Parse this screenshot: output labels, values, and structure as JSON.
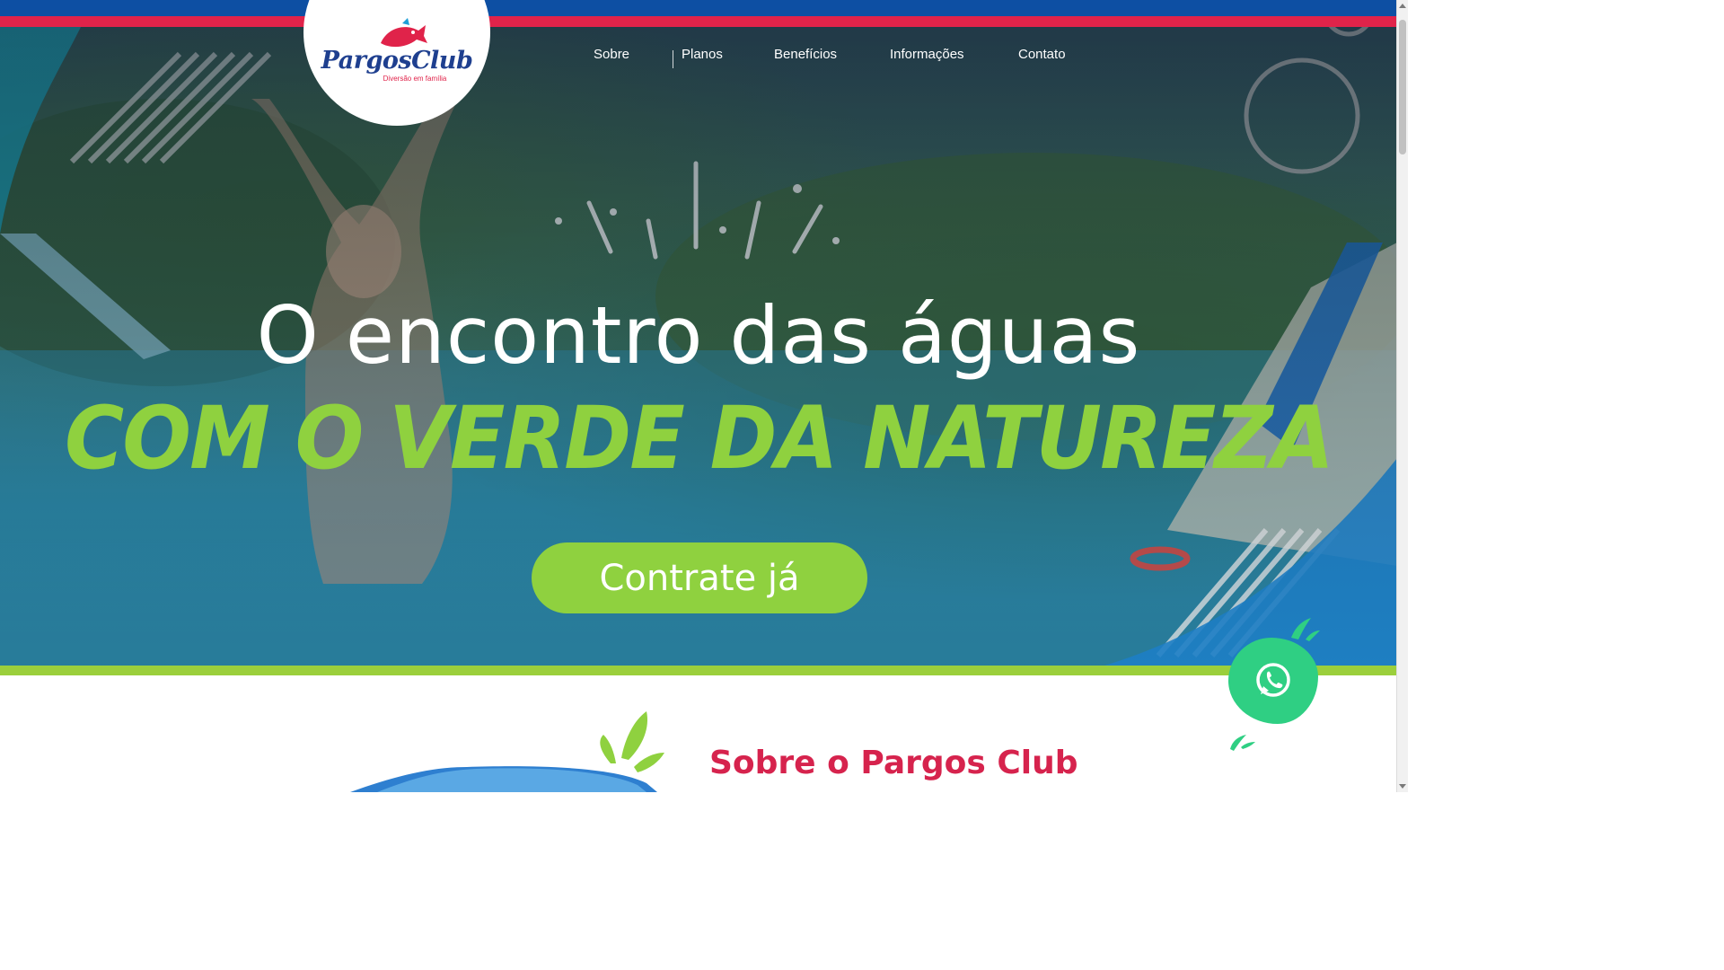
{
  "header": {
    "logo": {
      "name_part1": "Pargos",
      "name_part2": "Club",
      "tagline": "Diversão em família"
    },
    "nav": [
      {
        "label": "Sobre"
      },
      {
        "label": "Planos"
      },
      {
        "label": "Benefícios"
      },
      {
        "label": "Informações"
      },
      {
        "label": "Contato"
      }
    ]
  },
  "hero": {
    "headline_line1": "O encontro das águas",
    "headline_line2": "COM O VERDE DA NATUREZA",
    "cta_label": "Contrate já"
  },
  "floating": {
    "whatsapp_icon": "whatsapp-icon"
  },
  "about": {
    "title": "Sobre o Pargos Club"
  },
  "colors": {
    "brand_blue": "#0d4fa3",
    "brand_red": "#e0234a",
    "accent_green": "#8fd13f",
    "whatsapp_green": "#2fcf83",
    "section_title": "#d6234d"
  }
}
